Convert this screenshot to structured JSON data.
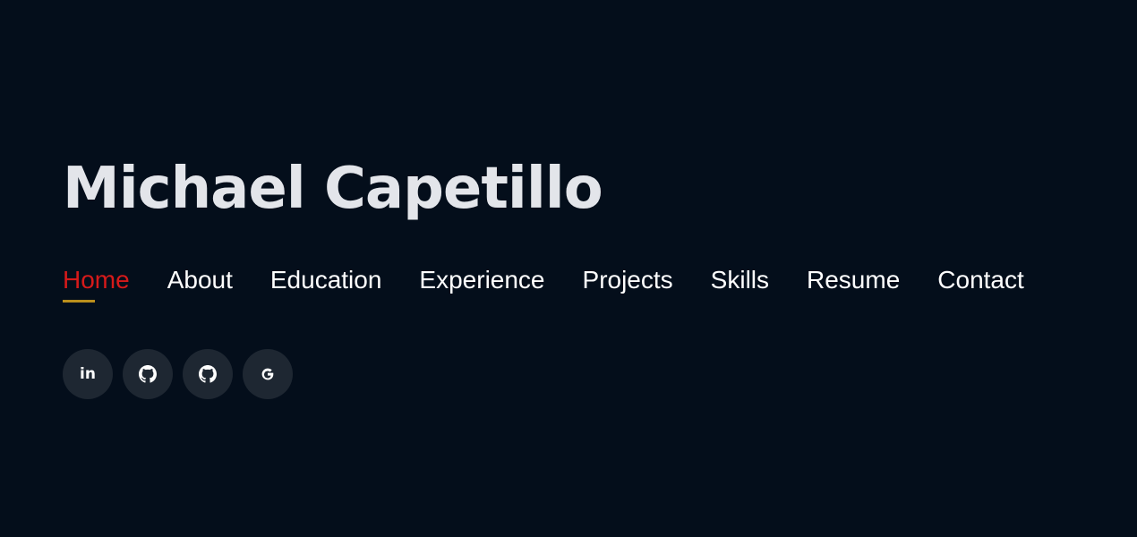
{
  "header": {
    "name": "Michael Capetillo"
  },
  "nav": {
    "active_index": 0,
    "items": [
      {
        "label": "Home"
      },
      {
        "label": "About"
      },
      {
        "label": "Education"
      },
      {
        "label": "Experience"
      },
      {
        "label": "Projects"
      },
      {
        "label": "Skills"
      },
      {
        "label": "Resume"
      },
      {
        "label": "Contact"
      }
    ]
  },
  "social": {
    "links": [
      {
        "icon": "linkedin-icon",
        "glyph": "in"
      },
      {
        "icon": "github-icon"
      },
      {
        "icon": "github-icon"
      },
      {
        "icon": "google-icon"
      }
    ]
  },
  "colors": {
    "background": "#040e1b",
    "title": "#e3e5ea",
    "nav_text": "#ffffff",
    "nav_active": "#d61a1a",
    "nav_underline": "#bb8f1c",
    "social_bg": "#1e2732"
  }
}
